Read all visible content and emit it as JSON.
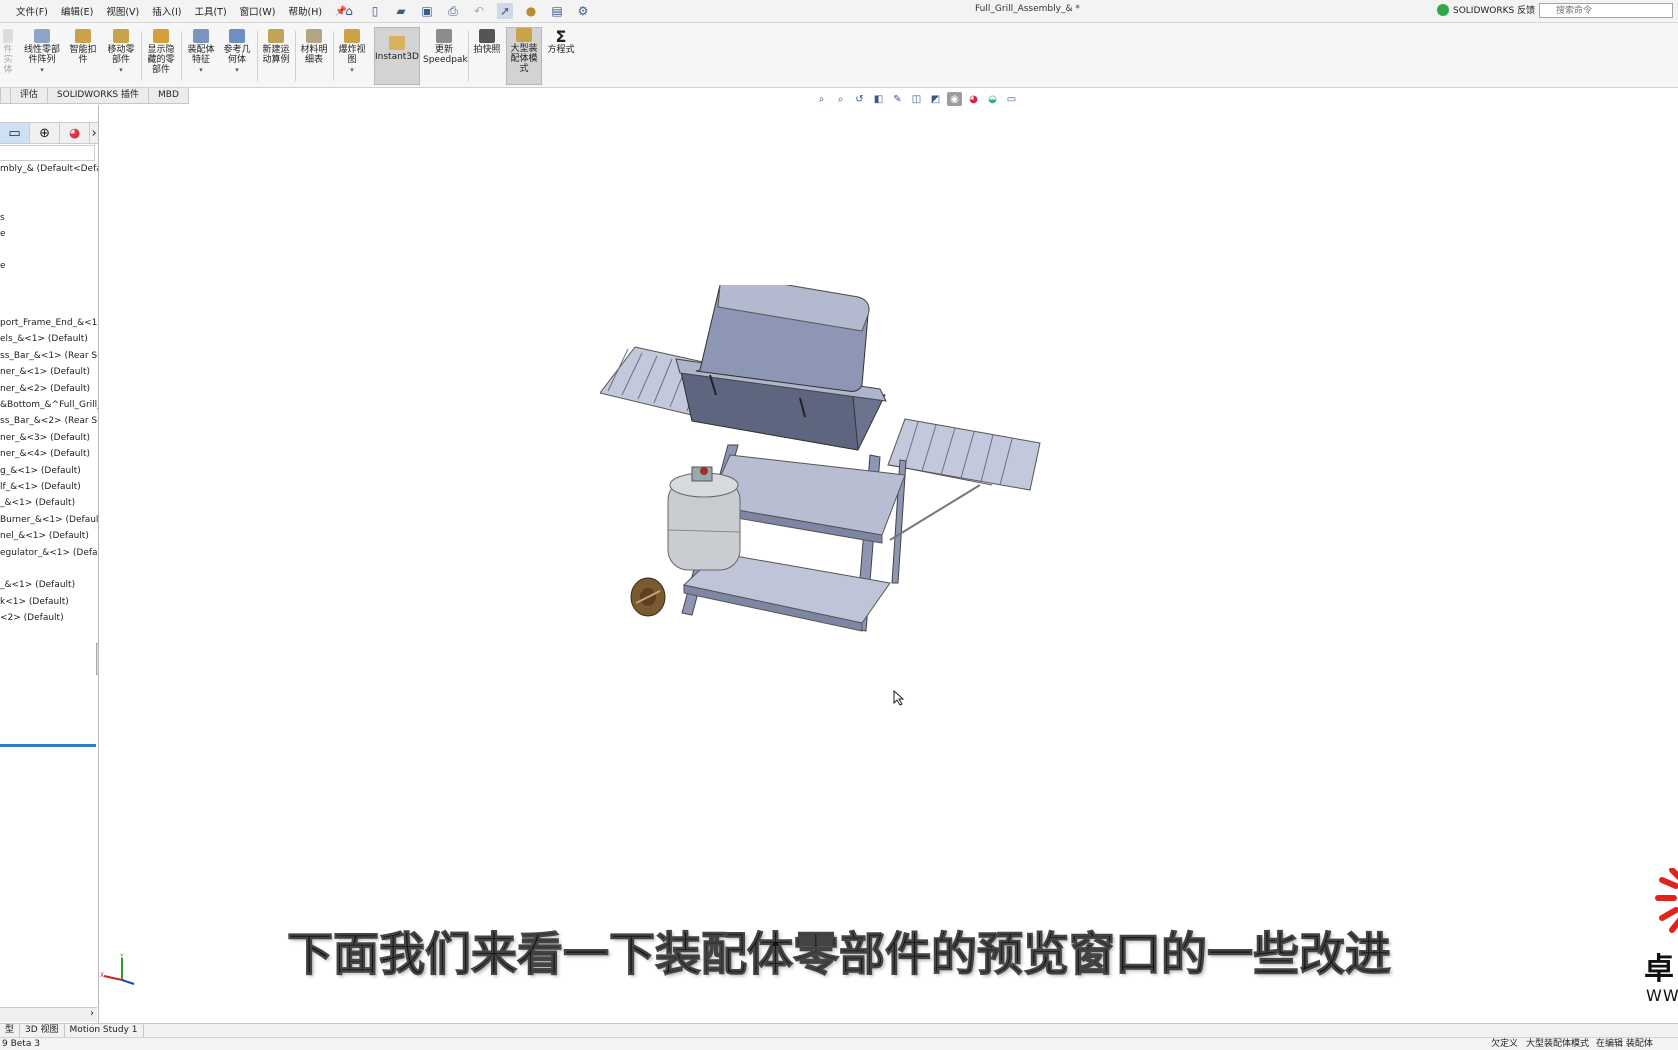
{
  "menu": [
    "文件(F)",
    "编辑(E)",
    "视图(V)",
    "插入(I)",
    "工具(T)",
    "窗口(W)",
    "帮助(H)"
  ],
  "document_title": "Full_Grill_Assembly_& *",
  "feedback_label": "SOLIDWORKS 反馈",
  "search_placeholder": "搜索命令",
  "ribbon": {
    "partial_first": "件\n实体",
    "linear_pattern": "线性零部\n件阵列",
    "smart_fasteners": "智能扣\n件",
    "move_component": "移动零\n部件",
    "show_hidden": "显示隐\n藏的零\n部件",
    "assembly_features": "装配体\n特征",
    "reference_geometry": "参考几\n何体",
    "new_motion_study": "新建运\n动算例",
    "bom": "材料明\n细表",
    "exploded_view": "爆炸视\n图",
    "instant3d": "Instant3D",
    "update_speedpak": "更新\nSpeedpak",
    "snapshot": "拍快照",
    "large_assembly": "大型装\n配体模\n式",
    "equations": "方程式"
  },
  "command_tabs": [
    "评估",
    "SOLIDWORKS 插件",
    "MBD"
  ],
  "tree": {
    "root": "mbly_&  (Default<Defa",
    "folders": [
      "s",
      "e",
      "e"
    ],
    "components": [
      "port_Frame_End_&<1>",
      "els_&<1> (Default)",
      "ss_Bar_&<1> (Rear Su",
      "ner_&<1> (Default)",
      "ner_&<2> (Default)",
      "&Bottom_&^Full_Grill_",
      "ss_Bar_&<2> (Rear Su",
      "ner_&<3> (Default)",
      "ner_&<4> (Default)",
      "g_&<1> (Default)",
      "lf_&<1> (Default)",
      "_&<1> (Default)",
      "Burner_&<1> (Default",
      "nel_&<1> (Default)",
      "egulator_&<1> (Defaul",
      "",
      "_&<1> (Default)",
      "k<1> (Default)",
      "<2> (Default)"
    ]
  },
  "bottom_tabs": [
    "型",
    "3D 视图",
    "Motion Study 1"
  ],
  "status": {
    "left": "9 Beta 3",
    "right": [
      "欠定义",
      "大型装配体模式",
      "在编辑 装配体"
    ]
  },
  "caption": "下面我们来看一下装配体零部件的预览窗口的一些改进",
  "watermark": {
    "char": "卓",
    "url": "WWW"
  },
  "colors": {
    "grill_body": "#8e96b6",
    "grill_light": "#c3c8dc",
    "tank": "#c9cdd2",
    "wheel": "#7a5a33",
    "accent": "#2e7dc6",
    "feedback_green": "#2fa84a",
    "watermark_red": "#e0241b"
  }
}
